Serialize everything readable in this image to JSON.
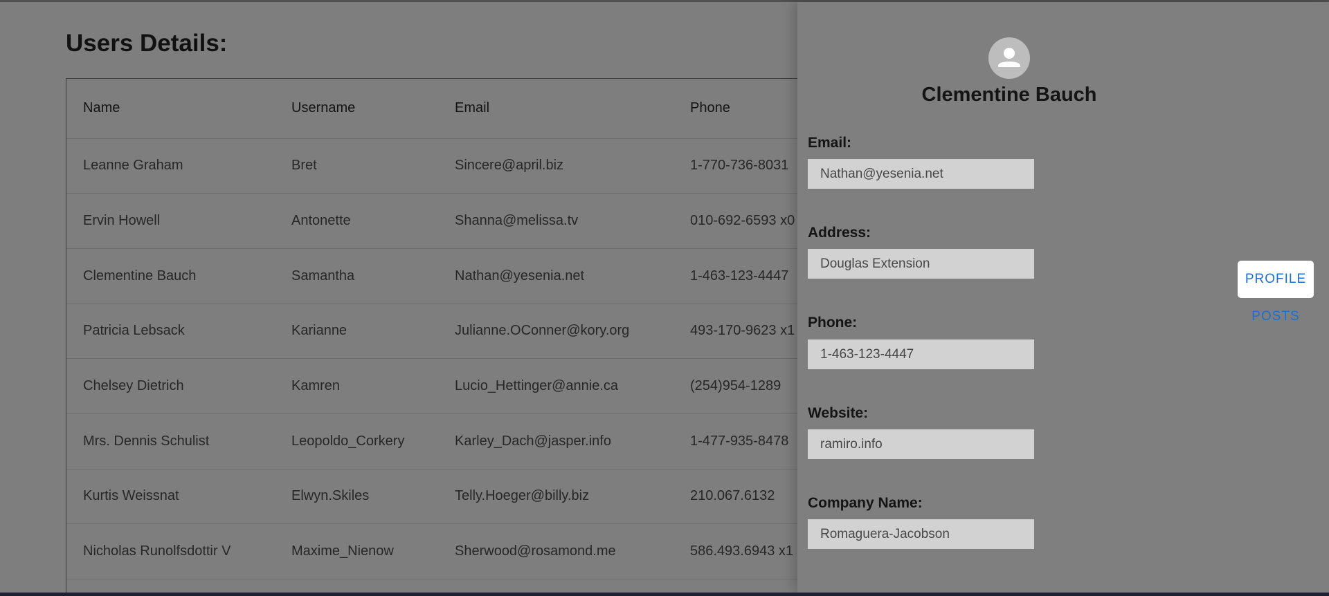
{
  "page": {
    "title": "Users Details:"
  },
  "table": {
    "headers": [
      "Name",
      "Username",
      "Email",
      "Phone"
    ],
    "rows": [
      [
        "Leanne Graham",
        "Bret",
        "Sincere@april.biz",
        "1-770-736-8031"
      ],
      [
        "Ervin Howell",
        "Antonette",
        "Shanna@melissa.tv",
        "010-692-6593 x0"
      ],
      [
        "Clementine Bauch",
        "Samantha",
        "Nathan@yesenia.net",
        "1-463-123-4447"
      ],
      [
        "Patricia Lebsack",
        "Karianne",
        "Julianne.OConner@kory.org",
        "493-170-9623 x1"
      ],
      [
        "Chelsey Dietrich",
        "Kamren",
        "Lucio_Hettinger@annie.ca",
        "(254)954-1289"
      ],
      [
        "Mrs. Dennis Schulist",
        "Leopoldo_Corkery",
        "Karley_Dach@jasper.info",
        "1-477-935-8478"
      ],
      [
        "Kurtis Weissnat",
        "Elwyn.Skiles",
        "Telly.Hoeger@billy.biz",
        "210.067.6132"
      ],
      [
        "Nicholas Runolfsdottir V",
        "Maxime_Nienow",
        "Sherwood@rosamond.me",
        "586.493.6943 x1"
      ]
    ]
  },
  "drawer": {
    "avatar_icon": "person-icon",
    "name": "Clementine Bauch",
    "email_label": "Email:",
    "email_value": "Nathan@yesenia.net",
    "address_label": "Address:",
    "address_value": "Douglas Extension",
    "phone_label": "Phone:",
    "phone_value": "1-463-123-4447",
    "website_label": "Website:",
    "website_value": "ramiro.info",
    "company_label": "Company Name:",
    "company_value": "Romaguera-Jacobson",
    "tabs": {
      "profile": "PROFILE",
      "posts": "POSTS"
    }
  },
  "colors": {
    "overlay": "#7e7e7e",
    "input_bg": "#d2d2d2",
    "accent": "#1e6fd0"
  }
}
